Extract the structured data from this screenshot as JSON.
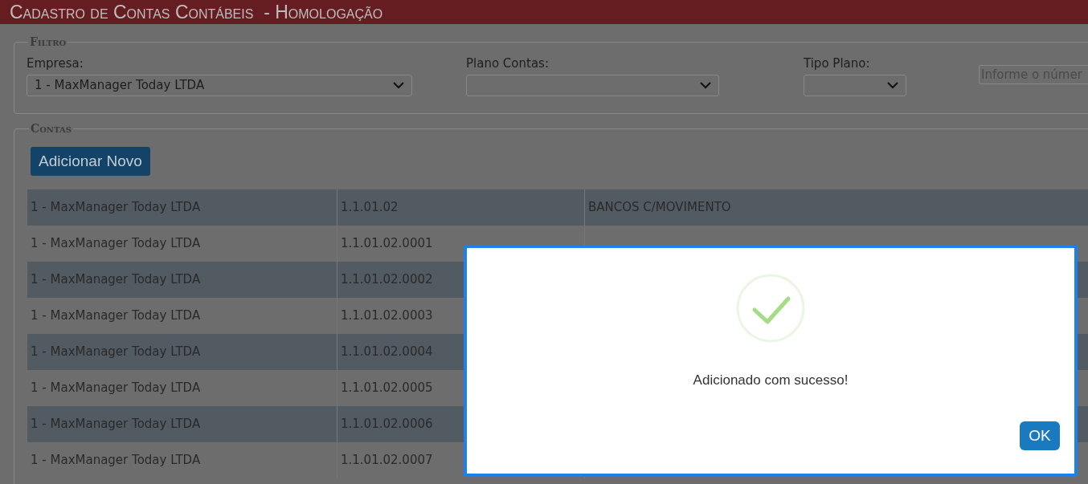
{
  "header": {
    "title": "Cadastro de Contas Contábeis  - Homologação"
  },
  "filter": {
    "legend": "Filtro",
    "fields": [
      {
        "kind": "select",
        "label": "Empresa:",
        "value": "1 - MaxManager Today LTDA"
      },
      {
        "kind": "select",
        "label": "Plano Contas:"
      },
      {
        "kind": "select",
        "label": "Tipo Plano:"
      },
      {
        "kind": "text",
        "placeholder": "Informe o númer"
      }
    ]
  },
  "accounts": {
    "legend": "Contas",
    "add_button": "Adicionar Novo",
    "rows": [
      {
        "company": "1 - MaxManager Today LTDA",
        "code": "1.1.01.02",
        "description": "BANCOS C/MOVIMENTO"
      },
      {
        "company": "1 - MaxManager Today LTDA",
        "code": "1.1.01.02.0001"
      },
      {
        "company": "1 - MaxManager Today LTDA",
        "code": "1.1.01.02.0002"
      },
      {
        "company": "1 - MaxManager Today LTDA",
        "code": "1.1.01.02.0003"
      },
      {
        "company": "1 - MaxManager Today LTDA",
        "code": "1.1.01.02.0004"
      },
      {
        "company": "1 - MaxManager Today LTDA",
        "code": "1.1.01.02.0005"
      },
      {
        "company": "1 - MaxManager Today LTDA",
        "code": "1.1.01.02.0006"
      },
      {
        "company": "1 - MaxManager Today LTDA",
        "code": "1.1.01.02.0007"
      }
    ]
  },
  "dialog": {
    "message": "Adicionado com sucesso!",
    "button": "OK"
  }
}
